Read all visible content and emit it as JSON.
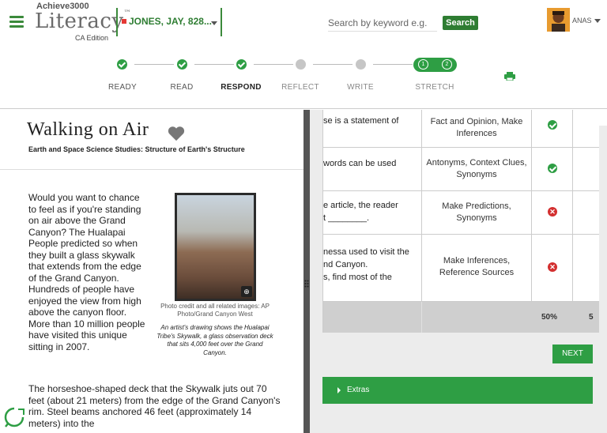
{
  "header": {
    "logo_top": "Achieve3000",
    "logo_main": "Literacy",
    "logo_tm": "™",
    "edition": "CA Edition",
    "student": "JONES, JAY, 828...",
    "search_placeholder": "Search by keyword e.g. ",
    "search_button": "Search",
    "user_name": "ANAS",
    "colors": {
      "accent": "#2e7d32",
      "step_done": "#2e9e44",
      "step_todo": "#c6c6c6"
    }
  },
  "steps": [
    {
      "label": "READY",
      "state": "done"
    },
    {
      "label": "READ",
      "state": "done"
    },
    {
      "label": "RESPOND",
      "state": "done"
    },
    {
      "label": "REFLECT",
      "state": "todo"
    },
    {
      "label": "WRITE",
      "state": "todo"
    },
    {
      "label": "STRETCH",
      "state": "current",
      "sub": [
        "1",
        "2"
      ]
    }
  ],
  "article": {
    "title": "Walking on Air",
    "subtitle": "Earth and Space Science Studies: Structure of Earth's Structure",
    "para1": "Would you want to chance to feel as if you're standing on air above the Grand Canyon? The Hualapai People predicted so when they built a glass skywalk that extends from the edge of the Grand Canyon. Hundreds of people have enjoyed the view from high above the canyon floor. More than 10 million people have visited this unique sitting in 2007.",
    "para2": "The horseshoe-shaped deck that the Skywalk juts out 70 feet (about 21 meters) from the edge of the Grand Canyon's rim. Steel beams anchored 46 feet (approximately 14 meters) into the",
    "photo_credit": "Photo credit and all related images: AP Photo/Grand Canyon West",
    "caption": "An artist's drawing shows the Hualapai Tribe's Skywalk, a glass observation deck that sits 4,000 feet over the Grand Canyon."
  },
  "table": {
    "rows": [
      {
        "q": "se is a statement of",
        "skills": "Fact and Opinion, Make Inferences",
        "result": "correct"
      },
      {
        "q": "words can be used",
        "skills": "Antonyms, Context Clues, Synonyms",
        "result": "correct"
      },
      {
        "q": "e article, the reader",
        "q2": "t ________.",
        "skills": "Make Predictions, Synonyms",
        "result": "incorrect"
      },
      {
        "q": "nessa used to visit the",
        "q2": "nd Canyon.",
        "q3": "s, find most of the",
        "skills": "Make Inferences, Reference Sources",
        "result": "incorrect"
      }
    ],
    "totals": [
      "50%",
      "5"
    ],
    "correct_mark": "✓",
    "incorrect_mark": "✕"
  },
  "buttons": {
    "next": "NEXT",
    "extras": "Extras",
    "zoom": "⊕"
  }
}
